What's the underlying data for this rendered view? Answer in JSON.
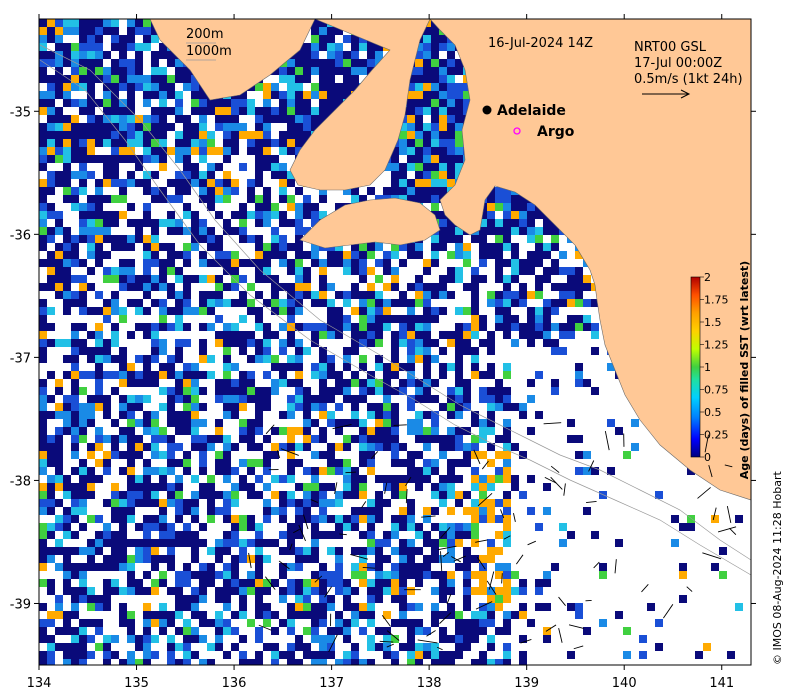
{
  "map": {
    "timestamp": "16-Jul-2024 14Z",
    "depth_legend": [
      "200m",
      "1000m"
    ],
    "current_info": {
      "line1": "NRT00 GSL",
      "line2": "17-Jul 00:00Z",
      "line3": "0.5m/s (1kt 24h)"
    },
    "places": [
      {
        "name": "Adelaide",
        "lon": 138.6,
        "lat": -34.93,
        "marker": "filled-circle",
        "color": "#000000"
      },
      {
        "name": "Argo",
        "lon": 138.87,
        "lat": -35.13,
        "marker": "open-circle",
        "color": "#ff00ff"
      }
    ],
    "credit": "© IMOS 08-Aug-2024 11:28 Hobart",
    "x_ticks": [
      "134",
      "135",
      "136",
      "137",
      "138",
      "139",
      "140",
      "141"
    ],
    "y_ticks": [
      "-35",
      "-36",
      "-37",
      "-38",
      "-39"
    ],
    "extent": {
      "lon_min": 134,
      "lon_max": 141.3,
      "lat_max": -34.25,
      "lat_min": -39.5
    },
    "colorbar": {
      "title": "Age (days) of filled SST (wrt latest)",
      "tick_labels": [
        "0",
        "0.25",
        "0.5",
        "0.75",
        "1",
        "1.25",
        "1.5",
        "1.75",
        "2"
      ],
      "range": [
        0,
        2
      ],
      "colors": [
        "#00007f",
        "#0000ff",
        "#0080ff",
        "#00d0ff",
        "#20e0a0",
        "#40d040",
        "#c0ff00",
        "#ffd000",
        "#ffa000",
        "#ff5000",
        "#b00000"
      ]
    },
    "colors": {
      "land": "#ffc896",
      "water_nodata": "#ffffff",
      "sst_age_0": "#0a0a7a",
      "sst_age_mid": "#1a6fd6",
      "sst_age_old": "#ffaa00"
    }
  }
}
